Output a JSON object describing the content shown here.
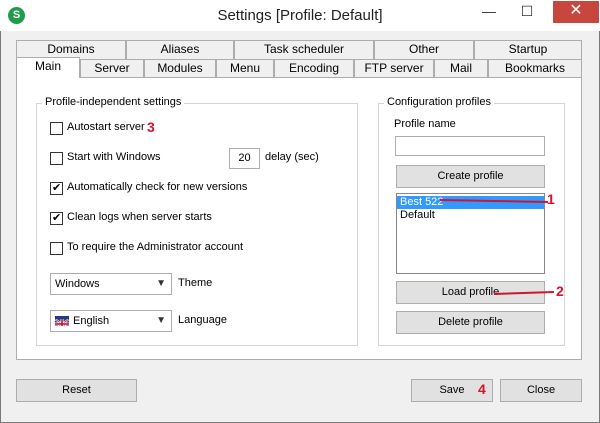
{
  "window": {
    "title": "Settings [Profile: Default]",
    "app_icon_letter": "S",
    "minimize_glyph": "—",
    "maximize_glyph": "☐",
    "close_glyph": "✕"
  },
  "tabs_row_back": [
    "Domains",
    "Aliases",
    "Task scheduler",
    "Other",
    "Startup"
  ],
  "tabs_row_front": [
    "Main",
    "Server",
    "Modules",
    "Menu",
    "Encoding",
    "FTP server",
    "Mail",
    "Bookmarks"
  ],
  "active_tab": "Main",
  "independent": {
    "title": "Profile-independent settings",
    "autostart": {
      "label": "Autostart server",
      "checked": false
    },
    "start_windows": {
      "label": "Start with Windows",
      "checked": false,
      "delay_value": "20",
      "delay_label": "delay (sec)"
    },
    "check_versions": {
      "label": "Automatically check for new versions",
      "checked": true
    },
    "clean_logs": {
      "label": "Clean logs when server starts",
      "checked": true
    },
    "require_admin": {
      "label": "To require the Administrator account",
      "checked": false
    },
    "theme": {
      "value": "Windows",
      "label": "Theme"
    },
    "language": {
      "value": "English",
      "label": "Language"
    }
  },
  "profiles": {
    "title": "Configuration profiles",
    "name_label": "Profile name",
    "name_value": "",
    "create_label": "Create profile",
    "list": [
      "Best 522",
      "Default"
    ],
    "selected": "Best 522",
    "load_label": "Load profile",
    "delete_label": "Delete profile"
  },
  "buttons": {
    "reset": "Reset",
    "save": "Save",
    "close": "Close"
  },
  "annotations": {
    "one": "1",
    "two": "2",
    "three": "3",
    "four": "4"
  },
  "colors": {
    "selection": "#3399ff",
    "annotation": "#d0152e",
    "close_button": "#c7463d",
    "app_icon": "#1e9e4a"
  }
}
